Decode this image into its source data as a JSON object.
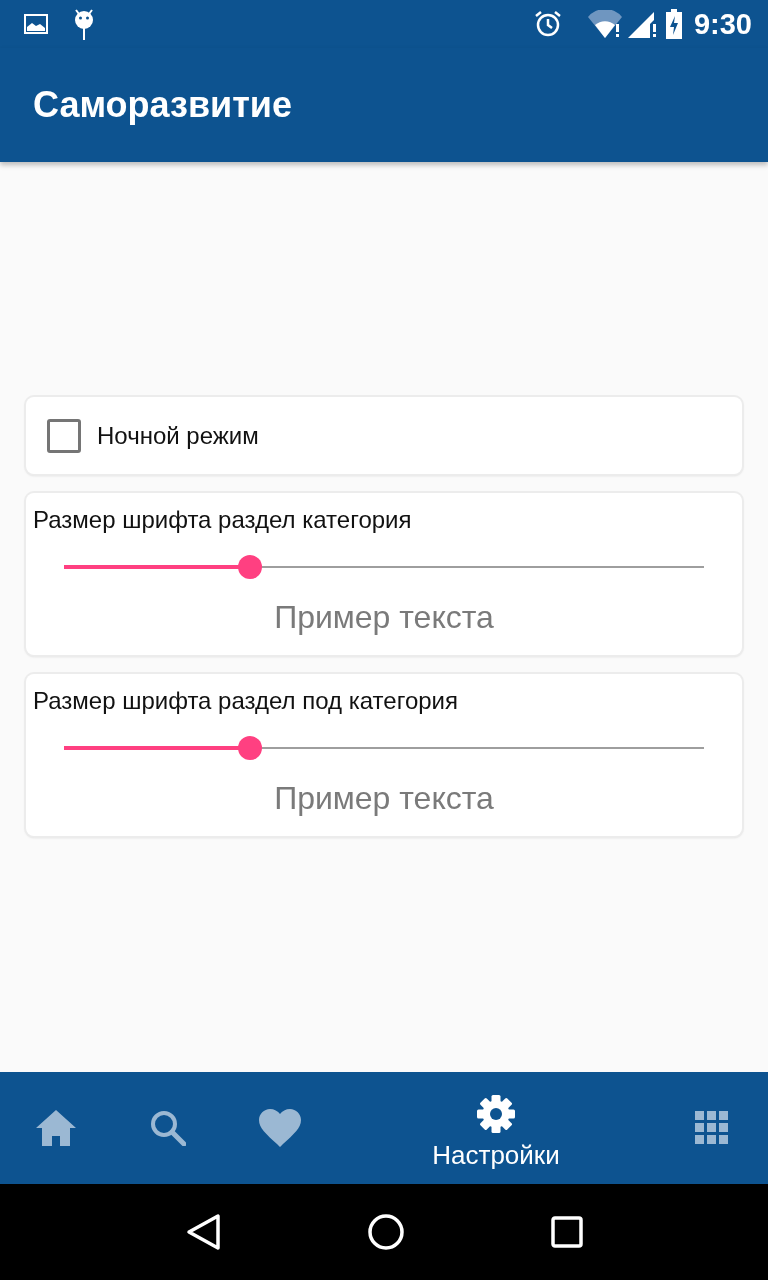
{
  "status_bar": {
    "time": "9:30"
  },
  "app_bar": {
    "title": "Саморазвитие"
  },
  "settings": [
    {
      "kind": "checkbox",
      "label": "Ночной режим",
      "checked": false
    },
    {
      "kind": "slider",
      "label": "Размер шрифта раздел категория",
      "level": 0.29,
      "sample": "Пример текста"
    },
    {
      "kind": "slider",
      "label": "Размер шрифта раздел под категория",
      "level": 0.29,
      "sample": "Пример текста"
    }
  ],
  "bottom_nav": [
    {
      "kind": "home",
      "selected": false
    },
    {
      "kind": "search",
      "selected": false
    },
    {
      "kind": "favorites",
      "selected": false
    },
    {
      "kind": "settings",
      "selected": true,
      "label": "Настройки"
    },
    {
      "kind": "apps",
      "selected": false
    }
  ]
}
